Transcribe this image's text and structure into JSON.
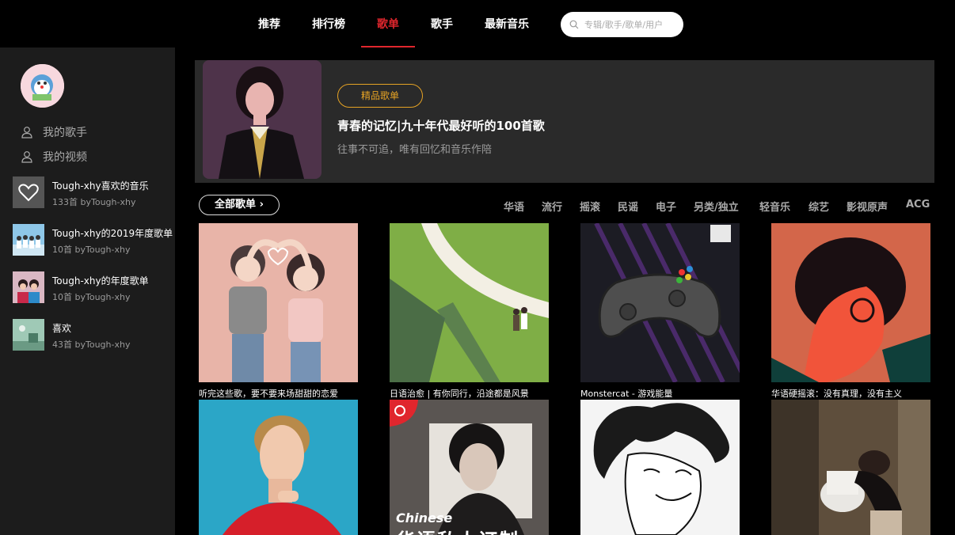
{
  "nav": {
    "items": [
      "推荐",
      "排行榜",
      "歌单",
      "歌手",
      "最新音乐"
    ],
    "active_index": 2,
    "search_placeholder": "专辑/歌手/歌单/用户"
  },
  "sidebar": {
    "links": [
      {
        "label": "我的歌手",
        "icon": "user-icon"
      },
      {
        "label": "我的视频",
        "icon": "user-icon"
      }
    ],
    "playlists": [
      {
        "title": "Tough-xhy喜欢的音乐",
        "subtitle": "133首 byTough-xhy"
      },
      {
        "title": "Tough-xhy的2019年度歌单",
        "subtitle": "10首 byTough-xhy"
      },
      {
        "title": "Tough-xhy的年度歌单",
        "subtitle": "10首 byTough-xhy"
      },
      {
        "title": "喜欢",
        "subtitle": "43首 byTough-xhy"
      }
    ]
  },
  "banner": {
    "badge": "精品歌单",
    "title": "青春的记忆|九十年代最好听的100首歌",
    "subtitle": "往事不可追，唯有回忆和音乐作陪"
  },
  "filters": {
    "all_label": "全部歌单 ›",
    "categories": [
      "华语",
      "流行",
      "摇滚",
      "民谣",
      "电子",
      "另类/独立",
      "轻音乐",
      "综艺",
      "影视原声",
      "ACG"
    ]
  },
  "grid": {
    "row1": [
      "听完这些歌，要不要来场甜甜的恋爱",
      "日语治愈 | 有你同行，沿途都是风景",
      "Monstercat - 游戏能量",
      "华语硬摇滚：没有真理，没有主义"
    ],
    "chinese_overlay_text": "Chinese",
    "chinese_overlay_cn": "华语私人订制"
  },
  "colors": {
    "accent": "#e0262d",
    "badge": "#e5a224",
    "sidebar_bg": "#1c1c1c",
    "banner_bg": "#2a2a2a"
  }
}
